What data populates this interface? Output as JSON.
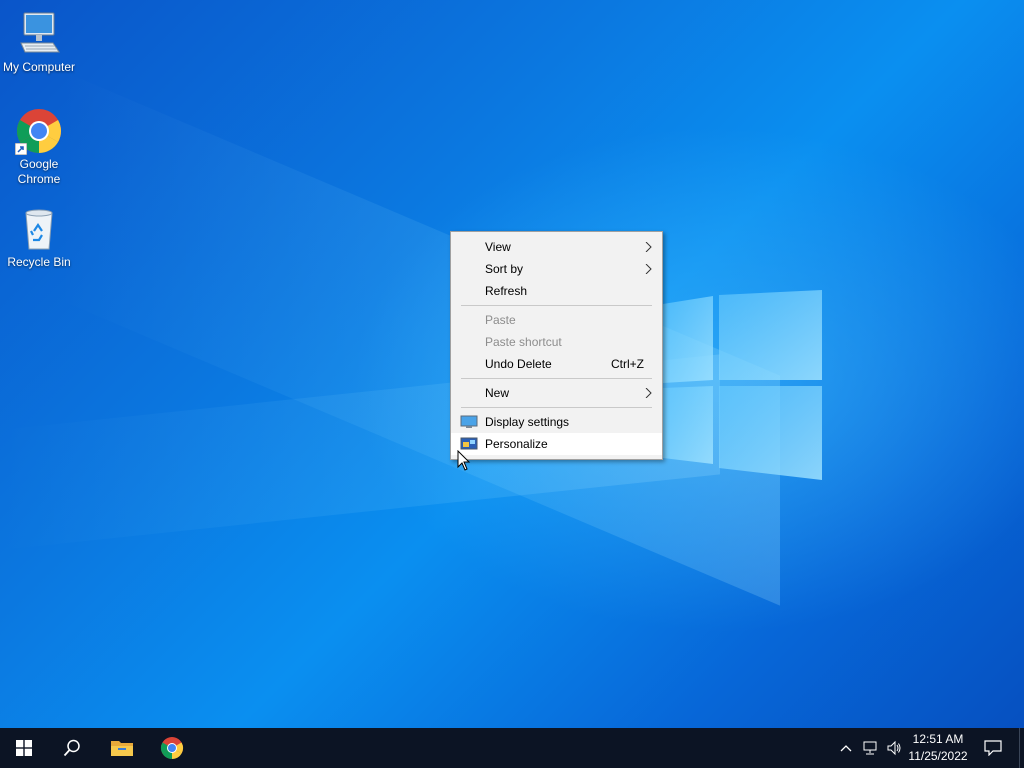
{
  "desktop": {
    "icons": [
      {
        "label": "My Computer"
      },
      {
        "label": "Google\nChrome"
      },
      {
        "label": "Recycle Bin"
      }
    ]
  },
  "context_menu": {
    "items": [
      {
        "label": "View",
        "submenu": true
      },
      {
        "label": "Sort by",
        "submenu": true
      },
      {
        "label": "Refresh"
      },
      {
        "label": "Paste",
        "disabled": true
      },
      {
        "label": "Paste shortcut",
        "disabled": true
      },
      {
        "label": "Undo Delete",
        "shortcut": "Ctrl+Z"
      },
      {
        "label": "New",
        "submenu": true
      },
      {
        "label": "Display settings",
        "icon": "display-icon"
      },
      {
        "label": "Personalize",
        "icon": "personalize-icon",
        "highlighted": true
      }
    ]
  },
  "taskbar": {
    "buttons": [
      {
        "name": "start",
        "icon": "windows-logo-icon"
      },
      {
        "name": "search",
        "icon": "search-icon"
      },
      {
        "name": "file-explorer",
        "icon": "folder-icon"
      },
      {
        "name": "chrome",
        "icon": "chrome-icon"
      }
    ],
    "tray": {
      "time": "12:51 AM",
      "date": "11/25/2022",
      "icons": [
        "chevron-up-icon",
        "network-icon",
        "volume-icon",
        "notification-icon"
      ]
    }
  },
  "colors": {
    "taskbar": "#0c1424",
    "menu_bg": "#f2f2f2",
    "desktop_blue": "#0a78e0"
  }
}
